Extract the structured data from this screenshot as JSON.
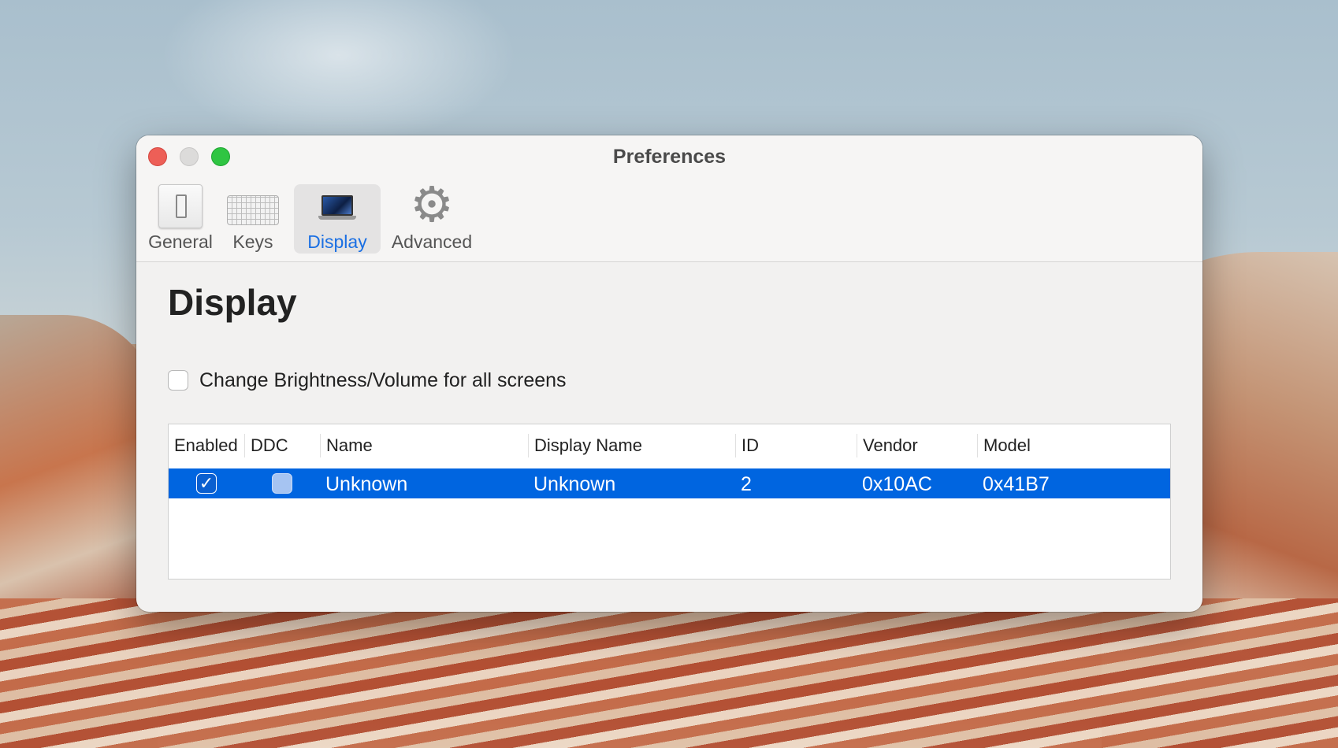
{
  "window": {
    "title": "Preferences"
  },
  "toolbar": {
    "items": [
      {
        "label": "General",
        "icon": "general-switch-icon",
        "selected": false
      },
      {
        "label": "Keys",
        "icon": "keyboard-icon",
        "selected": false
      },
      {
        "label": "Display",
        "icon": "laptop-display-icon",
        "selected": true
      },
      {
        "label": "Advanced",
        "icon": "gear-icon",
        "selected": false
      }
    ]
  },
  "content": {
    "title": "Display",
    "all_screens_checkbox": {
      "label": "Change Brightness/Volume for all screens",
      "checked": false
    }
  },
  "table": {
    "columns": [
      "Enabled",
      "DDC",
      "Name",
      "Display Name",
      "ID",
      "Vendor",
      "Model"
    ],
    "rows": [
      {
        "enabled": true,
        "ddc": false,
        "name": "Unknown",
        "display_name": "Unknown",
        "id": "2",
        "vendor": "0x10AC",
        "model": "0x41B7",
        "selected": true
      }
    ]
  },
  "colors": {
    "accent": "#0065e0",
    "selected_tab_label": "#1a6fe3",
    "close": "#ed5f57",
    "maximize": "#2fc542"
  }
}
